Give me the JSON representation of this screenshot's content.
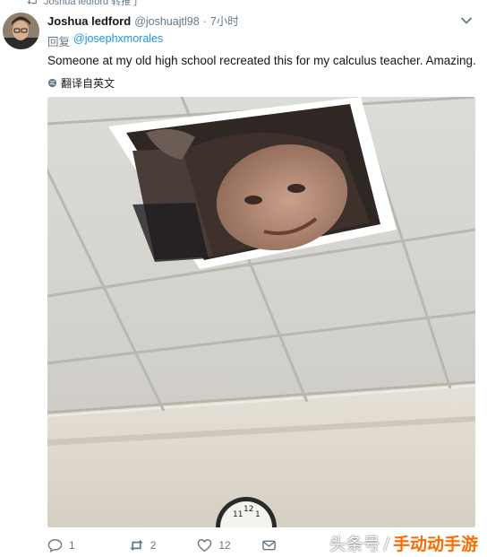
{
  "retweet": {
    "label": "Joshua ledford 转推了",
    "icon": "retweet-icon"
  },
  "tweet": {
    "display_name": "Joshua ledford",
    "handle": "@joshuajtl98",
    "separator": "·",
    "time": "7小时",
    "reply_prefix": "回复",
    "reply_to": "@josephxmorales",
    "text": "Someone at my old high school recreated this for my calculus teacher. Amazing.",
    "translate_label": "翻译自英文"
  },
  "actions": {
    "reply_count": "1",
    "retweet_count": "2",
    "like_count": "12"
  },
  "watermark": {
    "left": "头条号",
    "slash": "/",
    "brand": "手动动手游"
  },
  "colors": {
    "secondary_text": "#657786",
    "link": "#1b95e0",
    "brand_orange": "#ff6a00"
  }
}
